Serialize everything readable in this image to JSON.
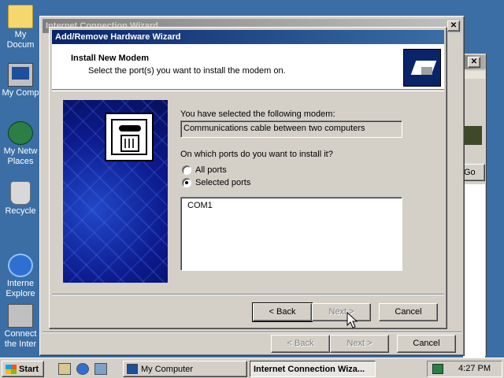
{
  "desktop": {
    "icons": [
      {
        "label": "My Docum",
        "icon": "folder-icon"
      },
      {
        "label": "My Comp",
        "icon": "computer-icon"
      },
      {
        "label": "My Netw Places",
        "icon": "network-icon"
      },
      {
        "label": "Recycle",
        "icon": "recycle-bin-icon"
      },
      {
        "label": "Interne Explore",
        "icon": "internet-explorer-icon"
      },
      {
        "label": "Connect the Inter",
        "icon": "connect-internet-icon"
      }
    ]
  },
  "background_window": {
    "title": "Internet Connection Wizard",
    "close_label": "✕",
    "back_label": "< Back",
    "next_label": "Next >",
    "cancel_label": "Cancel"
  },
  "right_window": {
    "close_label": "✕",
    "go_label": "Go"
  },
  "dialog": {
    "title": "Add/Remove Hardware Wizard",
    "header_title": "Install New Modem",
    "header_subtitle": "Select the port(s) you want to install the modem on.",
    "selected_modem_label": "You have selected the following modem:",
    "selected_modem_value": "Communications cable between two computers",
    "ports_question": "On which ports do you want to install it?",
    "radio_all_ports": "All ports",
    "radio_selected_ports": "Selected ports",
    "selected_option": "Selected ports",
    "ports": [
      "COM1"
    ],
    "back_label": "< Back",
    "next_label": "Next >",
    "cancel_label": "Cancel"
  },
  "taskbar": {
    "start_label": "Start",
    "quick_launch": [
      "show-desktop-icon",
      "internet-explorer-icon",
      "network-icon"
    ],
    "tasks": [
      {
        "label": "My Computer",
        "active": false
      },
      {
        "label": "Internet Connection Wiza...",
        "active": true
      }
    ],
    "clock": "4:27 PM"
  }
}
